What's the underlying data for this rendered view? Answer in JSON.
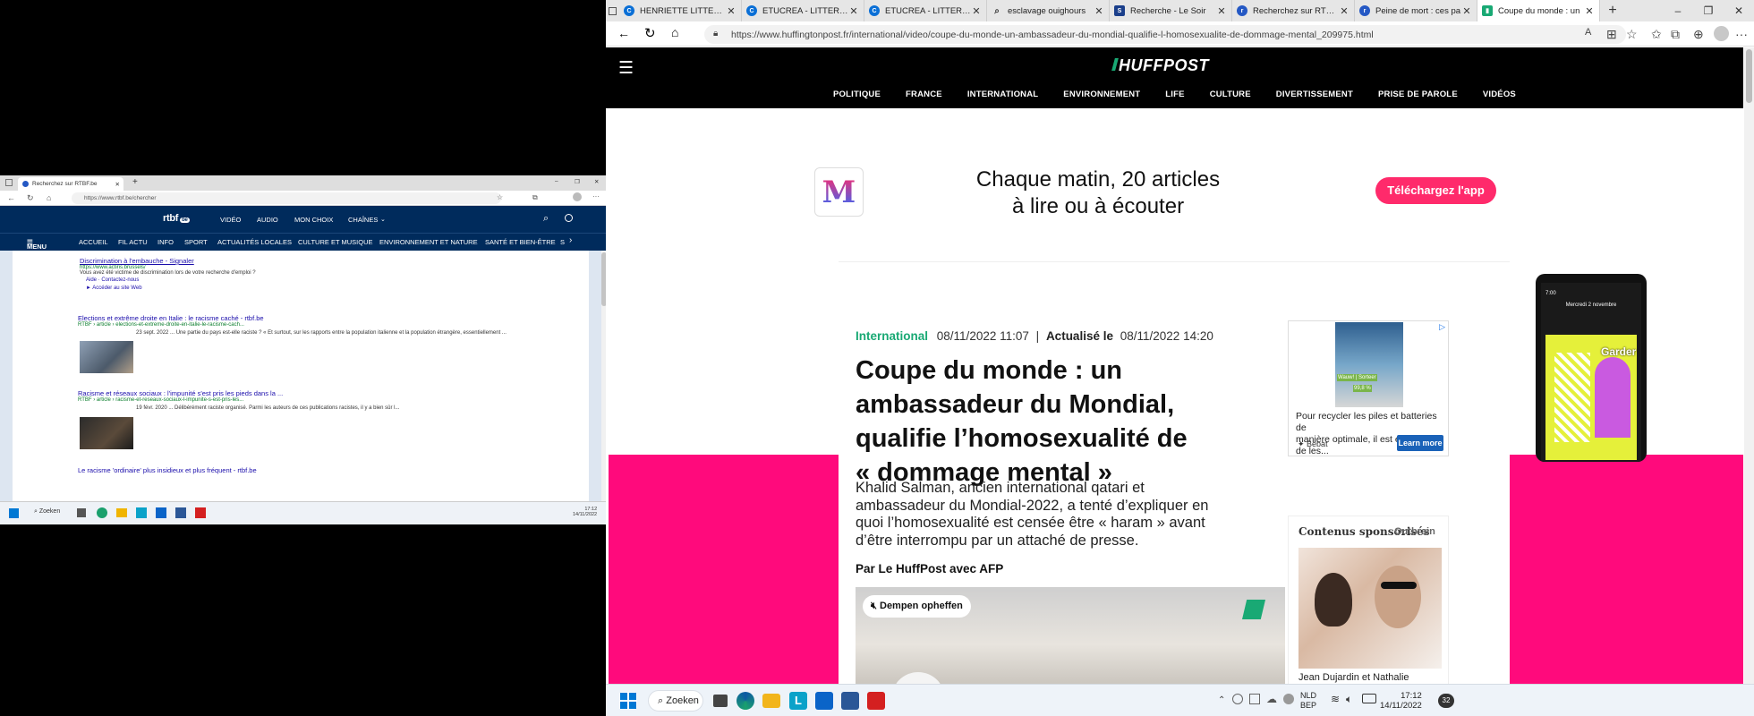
{
  "right_browser": {
    "tabs": [
      {
        "title": "HENRIETTE LITTERATU",
        "fav_color": "#0a6fd6",
        "fav_glyph": "C"
      },
      {
        "title": "ETUCREA - LITTERATU",
        "fav_color": "#0a6fd6",
        "fav_glyph": "C"
      },
      {
        "title": "ETUCREA - LITTERATU",
        "fav_color": "#0a6fd6",
        "fav_glyph": "C"
      },
      {
        "title": "esclavage ouighours",
        "fav_color": "#5c6b7a",
        "fav_glyph": "⌕"
      },
      {
        "title": "Recherche - Le Soir",
        "fav_color": "#1b3f8b",
        "fav_glyph": "S"
      },
      {
        "title": "Recherchez sur RTBF.b",
        "fav_color": "#2458c4",
        "fav_glyph": "r"
      },
      {
        "title": "Peine de mort : ces pa",
        "fav_color": "#2458c4",
        "fav_glyph": "r"
      },
      {
        "title": "Coupe du monde : un",
        "fav_color": "#19a974",
        "fav_glyph": "▮"
      }
    ],
    "new_tab": "+",
    "window_controls": {
      "minimize": "–",
      "maximize": "❐",
      "close": "✕"
    },
    "url": "https://www.huffingtonpost.fr/international/video/coupe-du-monde-un-ambassadeur-du-mondial-qualifie-l-homosexualite-de-dommage-mental_209975.html"
  },
  "huffpost": {
    "logo": "HUFFPOST",
    "nav": [
      "POLITIQUE",
      "FRANCE",
      "INTERNATIONAL",
      "ENVIRONNEMENT",
      "LIFE",
      "CULTURE",
      "DIVERTISSEMENT",
      "PRISE DE PAROLE",
      "VIDÉOS"
    ],
    "banner": {
      "logo_letter": "M",
      "text_line1": "Chaque matin, 20 articles",
      "text_line2": "à lire ou à écouter",
      "cta": "Téléchargez l'app"
    },
    "phone": {
      "time": "7:00",
      "date": "Mercredi 2 novembre",
      "word": "Garder"
    },
    "article": {
      "category": "International",
      "published": "08/11/2022 11:07",
      "sep": "|",
      "updated_label": "Actualisé le",
      "updated": "08/11/2022 14:20",
      "headline_l1": "Coupe du monde : un",
      "headline_l2": "ambassadeur du Mondial,",
      "headline_l3": "qualifie l’homosexualité de",
      "headline_l4": "« dommage mental »",
      "lede_l1": "Khalid Salman, ancien international qatari et",
      "lede_l2": "ambassadeur du Mondial-2022, a tenté d’expliquer en",
      "lede_l3": "quoi l’homosexualité est censée être « haram » avant",
      "lede_l4": "d’être interrompu par un attaché de presse.",
      "byline": "Par Le HuffPost avec AFP",
      "video_mute": "Dempen opheffen"
    },
    "ad": {
      "text_l1": "Pour recycler les piles et batteries de",
      "text_l2": "manière optimale, il est essentiel de les...",
      "brand": "Bebat",
      "cta": "Learn more",
      "img_line1": "Wauw! | Sorteer",
      "img_line2": "99,8 %"
    },
    "sponsored": {
      "title": "Contenus sponsorisés",
      "provider": "Outbrain",
      "caption": "Jean Dujardin et Nathalie"
    }
  },
  "left_browser": {
    "tab_title": "Recherchez sur RTBF.be",
    "url": "https://www.rtbf.be/chercher",
    "rtbf": {
      "logo": "rtbf",
      "logo_badge": "be",
      "top_links": [
        "VIDÉO",
        "AUDIO",
        "MON CHOIX",
        "CHAÎNES"
      ],
      "menu": "MENU",
      "nav": [
        "ACCUEIL",
        "FIL ACTU",
        "INFO",
        "SPORT",
        "ACTUALITÉS LOCALES",
        "CULTURE ET MUSIQUE",
        "ENVIRONNEMENT ET NATURE",
        "SANTÉ ET BIEN-ÊTRE",
        "S"
      ]
    },
    "results": [
      {
        "title": "Discrimination à l'embauche - Signaler",
        "url": "https://www.actiris.brussels/",
        "desc": "Vous avez été victime de discrimination lors de votre recherche d'emploi ?",
        "links": "Aide · Contactez-nous",
        "extra": "► Accéder au site Web"
      },
      {
        "title": "Elections et extrême droite en Italie : le racisme caché - rtbf.be",
        "url": "RTBF › article › elections-et-extreme-droite-en-italie-le-racisme-cach...",
        "desc": "23 sept. 2022 ... Une partie du pays est-elle raciste ? « Et surtout, sur les rapports entre la population italienne et la population étrangère, essentiellement ..."
      },
      {
        "title": "Racisme et réseaux sociaux : l'impunité s'est pris les pieds dans la ...",
        "url": "RTBF › article › racisme-et-reseaux-sociaux-l-impunite-s-est-pris-les...",
        "desc": "19 févr. 2020 ... Délibérément raciste organisé. Parmi les auteurs de ces publications racistes, il y a bien sûr l..."
      },
      {
        "title": "Le racisme 'ordinaire' plus insidieux et plus fréquent - rtbf.be",
        "url": "",
        "desc": ""
      }
    ],
    "taskbar": {
      "search": "Zoeken",
      "time": "17:12",
      "date": "14/11/2022"
    }
  },
  "taskbar": {
    "search": "Zoeken",
    "lang_l1": "NLD",
    "lang_l2": "BEP",
    "time": "17:12",
    "date": "14/11/2022",
    "badge": "32"
  }
}
